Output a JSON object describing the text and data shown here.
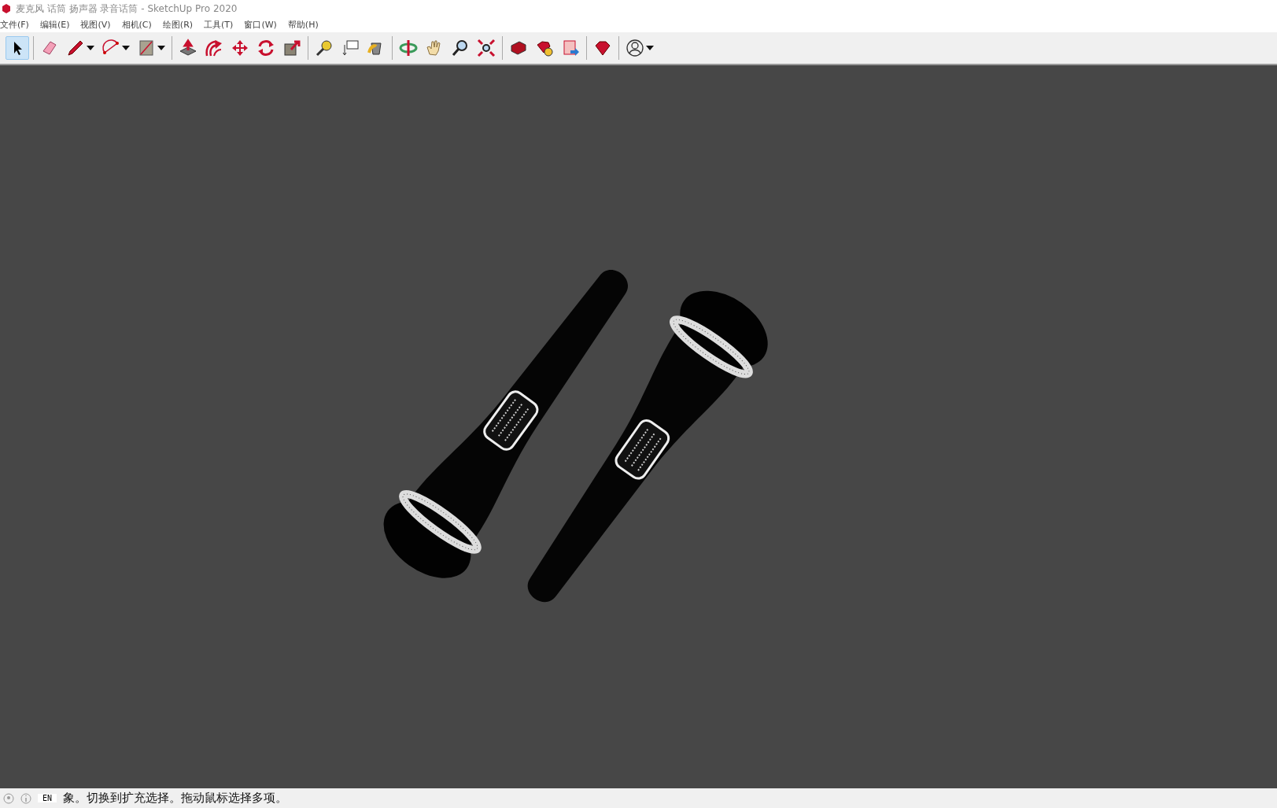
{
  "window": {
    "title": "麦克风 话筒 扬声器 录音话筒 - SketchUp Pro 2020"
  },
  "menu": [
    "文件(F)",
    "编辑(E)",
    "视图(V)",
    "相机(C)",
    "绘图(R)",
    "工具(T)",
    "窗口(W)",
    "帮助(H)"
  ],
  "toolbar": [
    [
      {
        "kind": "select",
        "selected": true,
        "dropdown": false
      }
    ],
    [
      {
        "kind": "eraser",
        "selected": false,
        "dropdown": false
      },
      {
        "kind": "pencil",
        "selected": false,
        "dropdown": true
      },
      {
        "kind": "arc",
        "selected": false,
        "dropdown": true
      },
      {
        "kind": "rectangle",
        "selected": false,
        "dropdown": true
      }
    ],
    [
      {
        "kind": "pushpull",
        "selected": false,
        "dropdown": false
      },
      {
        "kind": "offset",
        "selected": false,
        "dropdown": false
      },
      {
        "kind": "move",
        "selected": false,
        "dropdown": false
      },
      {
        "kind": "rotate",
        "selected": false,
        "dropdown": false
      },
      {
        "kind": "scale",
        "selected": false,
        "dropdown": false
      }
    ],
    [
      {
        "kind": "tape",
        "selected": false,
        "dropdown": false
      },
      {
        "kind": "text",
        "selected": false,
        "dropdown": false
      },
      {
        "kind": "paint",
        "selected": false,
        "dropdown": false
      }
    ],
    [
      {
        "kind": "orbit",
        "selected": false,
        "dropdown": false
      },
      {
        "kind": "pan",
        "selected": false,
        "dropdown": false
      },
      {
        "kind": "zoom",
        "selected": false,
        "dropdown": false
      },
      {
        "kind": "extents",
        "selected": false,
        "dropdown": false
      }
    ],
    [
      {
        "kind": "warehouse",
        "selected": false,
        "dropdown": false
      },
      {
        "kind": "extension",
        "selected": false,
        "dropdown": false
      },
      {
        "kind": "layout",
        "selected": false,
        "dropdown": false
      }
    ],
    [
      {
        "kind": "ruby",
        "selected": false,
        "dropdown": false
      }
    ],
    [
      {
        "kind": "account",
        "selected": false,
        "dropdown": true
      }
    ]
  ],
  "status_bar": {
    "ime": "EN",
    "message": "象。切换到扩充选择。拖动鼠标选择多项。"
  }
}
